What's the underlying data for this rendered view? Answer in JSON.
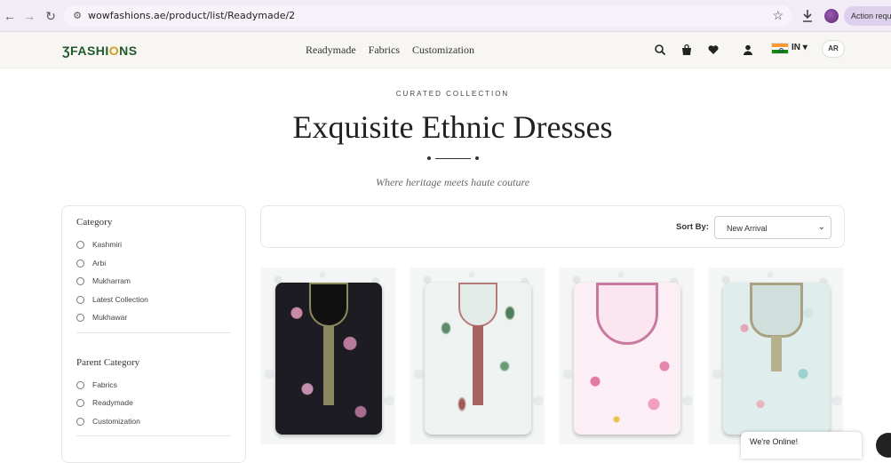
{
  "browser": {
    "url": "wowfashions.ae/product/list/Readymade/2",
    "action_label": "Action requi"
  },
  "header": {
    "logo_prefix": "ƷFASHI",
    "logo_o": "O",
    "logo_suffix": "NS",
    "nav": [
      "Readymade",
      "Fabrics",
      "Customization"
    ],
    "country": "IN ▾",
    "lang_button": "AR"
  },
  "hero": {
    "eyebrow": "CURATED COLLECTION",
    "title": "Exquisite Ethnic Dresses",
    "tagline": "Where heritage meets haute couture"
  },
  "sidebar": {
    "category_heading": "Category",
    "categories": [
      "Kashmiri",
      "Arbi",
      "Mukharram",
      "Latest Collection",
      "Mukhawar"
    ],
    "parent_heading": "Parent Category",
    "parent_categories": [
      "Fabrics",
      "Readymade",
      "Customization"
    ]
  },
  "sort": {
    "label": "Sort By:",
    "selected": "New Arrival"
  },
  "products": [
    {
      "style": "black-floral-kurta"
    },
    {
      "style": "sage-leaf-kurta"
    },
    {
      "style": "pink-floral-kurta"
    },
    {
      "style": "mint-floral-kurta"
    }
  ],
  "chat": {
    "text": "We're Online!"
  },
  "colors": {
    "brand_green": "#1f5a2b",
    "brand_gold": "#d59a1a"
  }
}
